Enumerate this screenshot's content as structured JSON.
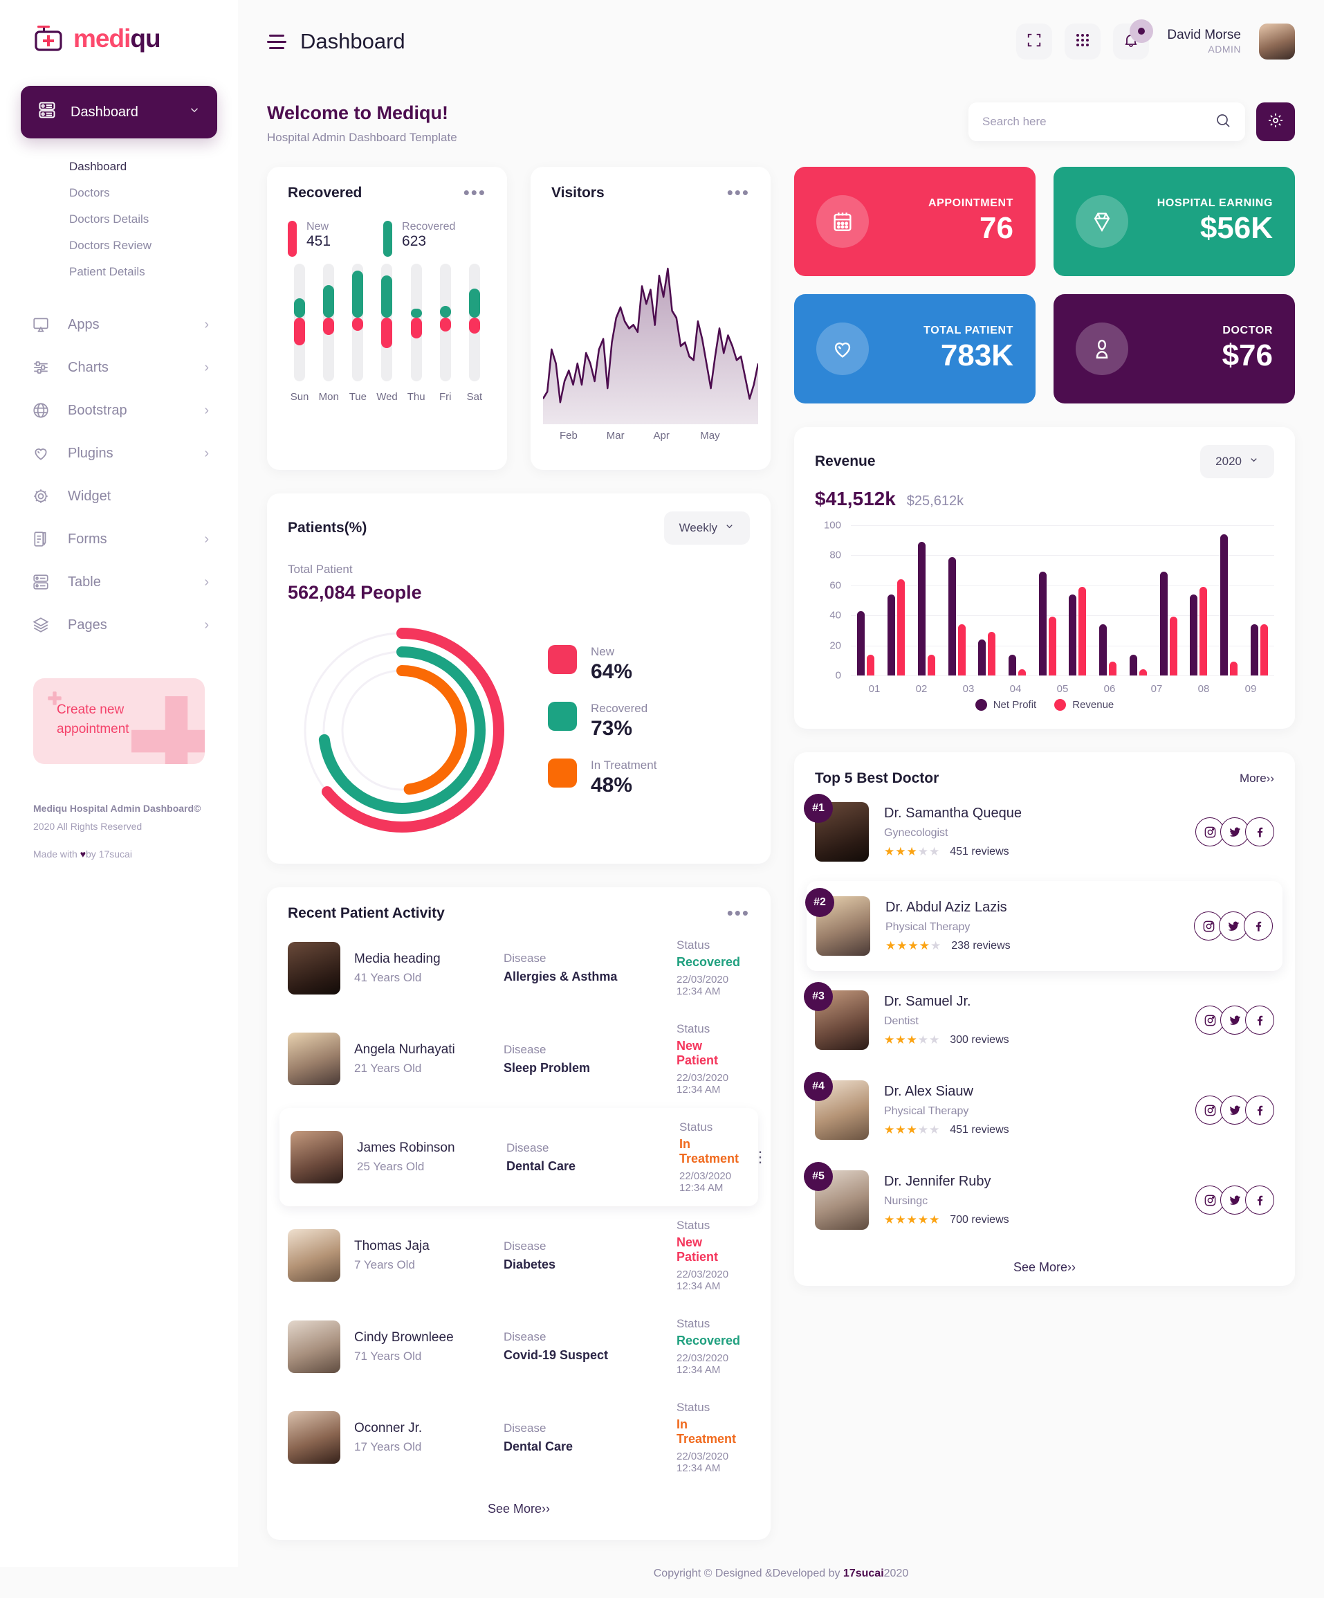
{
  "brand": {
    "part1": "medi",
    "part2": "qu"
  },
  "sidebar": {
    "main_item": {
      "label": "Dashboard",
      "icon": "dashboard-icon"
    },
    "sub_items": [
      {
        "label": "Dashboard",
        "active": true
      },
      {
        "label": "Doctors",
        "active": false
      },
      {
        "label": "Doctors Details",
        "active": false
      },
      {
        "label": "Doctors Review",
        "active": false
      },
      {
        "label": "Patient Details",
        "active": false
      }
    ],
    "items": [
      {
        "label": "Apps",
        "icon": "apps-icon",
        "arrow": "›"
      },
      {
        "label": "Charts",
        "icon": "sliders-icon",
        "arrow": "›"
      },
      {
        "label": "Bootstrap",
        "icon": "globe-icon",
        "arrow": "›"
      },
      {
        "label": "Plugins",
        "icon": "heart-icon",
        "arrow": "›"
      },
      {
        "label": "Widget",
        "icon": "gear-icon",
        "arrow": ""
      },
      {
        "label": "Forms",
        "icon": "forms-icon",
        "arrow": "›"
      },
      {
        "label": "Table",
        "icon": "table-icon",
        "arrow": "›"
      },
      {
        "label": "Pages",
        "icon": "layers-icon",
        "arrow": "›"
      }
    ],
    "promo": {
      "line1": "Create new",
      "line2": "appointment"
    },
    "footer": {
      "line1": "Mediqu Hospital Admin Dashboard©",
      "line2": "2020 All Rights Reserved",
      "line3_pre": "Made with ",
      "line3_heart": "♥",
      "line3_post": "by 17sucai"
    }
  },
  "topbar": {
    "page_title": "Dashboard",
    "user_name": "David Morse",
    "user_role": "ADMIN"
  },
  "welcome": {
    "title": "Welcome to Mediqu!",
    "subtitle": "Hospital Admin Dashboard Template",
    "search_placeholder": "Search here"
  },
  "recovered": {
    "title": "Recovered",
    "legend": [
      {
        "label": "New",
        "value": "451",
        "color": "#f9325b"
      },
      {
        "label": "Recovered",
        "value": "623",
        "color": "#20a07f"
      }
    ]
  },
  "visitors": {
    "title": "Visitors",
    "months": [
      "Feb",
      "Mar",
      "Apr",
      "May"
    ]
  },
  "stats": [
    {
      "label": "APPOINTMENT",
      "value": "76",
      "color": "#f4365c",
      "icon": "calendar-icon"
    },
    {
      "label": "HOSPITAL EARNING",
      "value": "$56K",
      "color": "#1ca383",
      "icon": "diamond-icon"
    },
    {
      "label": "TOTAL PATIENT",
      "value": "783K",
      "color": "#2e86d6",
      "icon": "heart-icon"
    },
    {
      "label": "DOCTOR",
      "value": "$76",
      "color": "#4d0d4f",
      "icon": "user-icon"
    }
  ],
  "patients": {
    "title": "Patients(%)",
    "period": "Weekly",
    "total_label": "Total Patient",
    "total_value": "562,084 People",
    "legend": [
      {
        "label": "New",
        "value": "64%",
        "color": "#f4365c"
      },
      {
        "label": "Recovered",
        "value": "73%",
        "color": "#1ca383"
      },
      {
        "label": "In Treatment",
        "value": "48%",
        "color": "#fa6a05"
      }
    ]
  },
  "activity": {
    "title": "Recent Patient Activity",
    "disease_label": "Disease",
    "status_label": "Status",
    "see_more": "See More››",
    "rows": [
      {
        "name": "Media heading",
        "age": "41 Years Old",
        "disease": "Allergies & Asthma",
        "status": "Recovered",
        "status_color": "#20a07f",
        "time": "22/03/2020 12:34 AM",
        "highlight": false,
        "menu": false,
        "av": "dk"
      },
      {
        "name": "Angela Nurhayati",
        "age": "21 Years Old",
        "disease": "Sleep Problem",
        "status": "New Patient",
        "status_color": "#f4365c",
        "time": "22/03/2020 12:34 AM",
        "highlight": false,
        "menu": false,
        "av": "bl"
      },
      {
        "name": "James Robinson",
        "age": "25 Years Old",
        "disease": "Dental Care",
        "status": "In Treatment",
        "status_color": "#f06a1e",
        "time": "22/03/2020 12:34 AM",
        "highlight": true,
        "menu": true,
        "av": "br"
      },
      {
        "name": "Thomas Jaja",
        "age": "7 Years Old",
        "disease": "Diabetes",
        "status": "New Patient",
        "status_color": "#f4365c",
        "time": "22/03/2020 12:34 AM",
        "highlight": false,
        "menu": false,
        "av": "wr"
      },
      {
        "name": "Cindy Brownleee",
        "age": "71 Years Old",
        "disease": "Covid-19 Suspect",
        "status": "Recovered",
        "status_color": "#20a07f",
        "time": "22/03/2020 12:34 AM",
        "highlight": false,
        "menu": false,
        "av": "gy"
      },
      {
        "name": "Oconner Jr.",
        "age": "17 Years Old",
        "disease": "Dental Care",
        "status": "In Treatment",
        "status_color": "#f06a1e",
        "time": "22/03/2020 12:34 AM",
        "highlight": false,
        "menu": false,
        "av": "dr"
      }
    ]
  },
  "revenue": {
    "title": "Revenue",
    "year": "2020",
    "primary_amount": "$41,512k",
    "secondary_amount": "$25,612k"
  },
  "doctors": {
    "title": "Top 5 Best Doctor",
    "more": "More››",
    "see_more": "See More››",
    "list": [
      {
        "rank": "#1",
        "name": "Dr. Samantha Queque",
        "specialty": "Gynecologist",
        "stars": 3,
        "reviews": "451 reviews",
        "highlight": false,
        "av": "dk"
      },
      {
        "rank": "#2",
        "name": "Dr. Abdul Aziz Lazis",
        "specialty": "Physical Therapy",
        "stars": 4,
        "reviews": "238 reviews",
        "highlight": true,
        "av": "bl"
      },
      {
        "rank": "#3",
        "name": "Dr. Samuel Jr.",
        "specialty": "Dentist",
        "stars": 3,
        "reviews": "300 reviews",
        "highlight": false,
        "av": "br"
      },
      {
        "rank": "#4",
        "name": "Dr. Alex Siauw",
        "specialty": "Physical Therapy",
        "stars": 3,
        "reviews": "451 reviews",
        "highlight": false,
        "av": "wr"
      },
      {
        "rank": "#5",
        "name": "Dr. Jennifer Ruby",
        "specialty": "Nursingc",
        "stars": 5,
        "reviews": "700 reviews",
        "highlight": false,
        "av": "gy"
      }
    ]
  },
  "footer": {
    "text_pre": "Copyright © Designed &Developed by ",
    "text_brand": "17sucai",
    "text_post": "2020"
  },
  "chart_data": [
    {
      "type": "bar",
      "title": "Recovered",
      "categories": [
        "Sun",
        "Mon",
        "Tue",
        "Wed",
        "Thu",
        "Fri",
        "Sat"
      ],
      "series": [
        {
          "name": "New",
          "color": "#f9325b",
          "values": [
            38,
            24,
            18,
            42,
            28,
            19,
            22
          ]
        },
        {
          "name": "Recovered",
          "color": "#20a07f",
          "values": [
            27,
            45,
            65,
            58,
            13,
            16,
            40
          ]
        }
      ],
      "ylim": [
        0,
        100
      ],
      "grid": false,
      "legend": "top",
      "notes": "Track-style vertical bars; New extends below baseline, Recovered above."
    },
    {
      "type": "area",
      "title": "Visitors",
      "xlabel": "",
      "ylabel": "",
      "tick_labels": [
        "Feb",
        "Mar",
        "Apr",
        "May"
      ],
      "line_color": "#4d0d4f",
      "values": [
        10,
        14,
        38,
        30,
        8,
        20,
        26,
        18,
        30,
        18,
        36,
        30,
        20,
        38,
        44,
        16,
        42,
        56,
        62,
        54,
        50,
        52,
        48,
        74,
        64,
        72,
        52,
        80,
        68,
        84,
        60,
        56,
        40,
        42,
        34,
        32,
        54,
        44,
        30,
        16,
        34,
        50,
        36,
        46,
        40,
        32,
        34,
        22,
        10,
        18,
        30
      ],
      "ylim": [
        0,
        100
      ],
      "grid": false
    },
    {
      "type": "bar",
      "title": "Revenue",
      "subtitle": "$41,512k  $25,612k",
      "categories": [
        "01",
        "02",
        "03",
        "04",
        "05",
        "06",
        "07",
        "08",
        "09"
      ],
      "bar_groups": 14,
      "series": [
        {
          "name": "Net Profit",
          "color": "#4d0d4f",
          "values": [
            43,
            54,
            89,
            79,
            24,
            14,
            69,
            54,
            34,
            14,
            69,
            54,
            94,
            34
          ]
        },
        {
          "name": "Revenue",
          "color": "#fa2d55",
          "values": [
            14,
            64,
            14,
            34,
            29,
            4,
            39,
            59,
            9,
            4,
            39,
            59,
            9,
            34
          ]
        }
      ],
      "ylim": [
        0,
        100
      ],
      "yticks": [
        0,
        20,
        40,
        60,
        80,
        100
      ],
      "grid": true,
      "legend": "bottom"
    },
    {
      "type": "pie",
      "title": "Patients(%)",
      "subtitle": "Total Patient 562,084 People",
      "labels": [
        "New",
        "Recovered",
        "In Treatment"
      ],
      "values": [
        64,
        73,
        48
      ],
      "colors": [
        "#f4365c",
        "#1ca383",
        "#fa6a05"
      ],
      "notes": "Rendered as three concentric radial progress rings."
    }
  ]
}
